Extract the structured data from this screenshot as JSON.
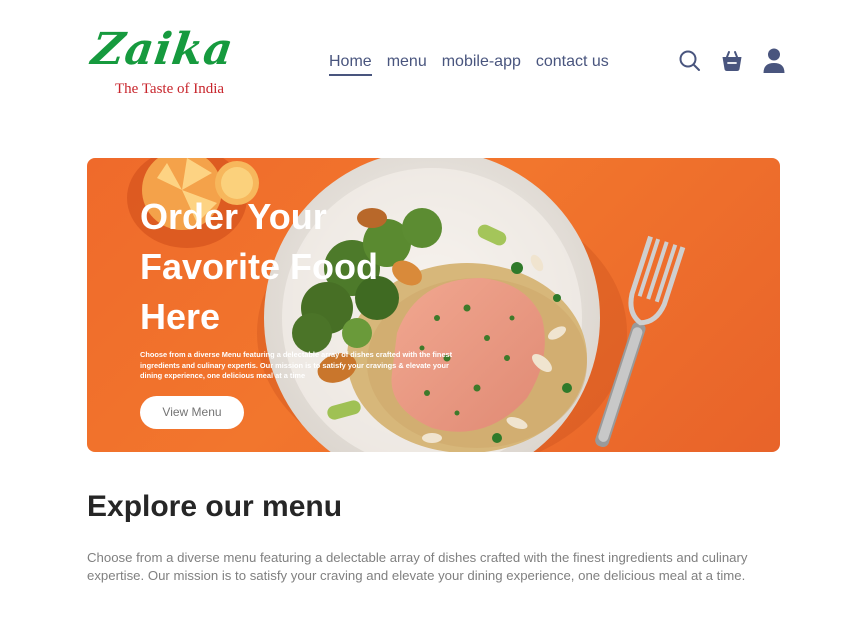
{
  "brand": {
    "name": "Zaika",
    "tagline": "The Taste of India",
    "brand_color": "#169a3e",
    "tagline_color": "#c8252c"
  },
  "nav": {
    "items": [
      {
        "label": "Home",
        "active": true
      },
      {
        "label": "menu",
        "active": false
      },
      {
        "label": "mobile-app",
        "active": false
      },
      {
        "label": "contact us",
        "active": false
      }
    ],
    "color": "#49557e"
  },
  "header_icons": [
    "search-icon",
    "basket-icon",
    "user-icon"
  ],
  "hero": {
    "title_line1": "Order Your",
    "title_line2": "Favorite Food",
    "title_line3": "Here",
    "description": "Choose from a diverse Menu featuring a delectable array of dishes crafted with the finest ingredients and culinary expertis. Our mission is to satisfy your cravings & elevate your dining experience, one delicious meal at a time",
    "button_label": "View Menu",
    "accent": "#ef6a2b"
  },
  "explore": {
    "title": "Explore our menu",
    "text": "Choose from a diverse menu featuring a delectable array of dishes crafted with the finest ingredients and culinary expertise. Our mission is to satisfy your craving and elevate your dining experience, one delicious meal at a time."
  }
}
